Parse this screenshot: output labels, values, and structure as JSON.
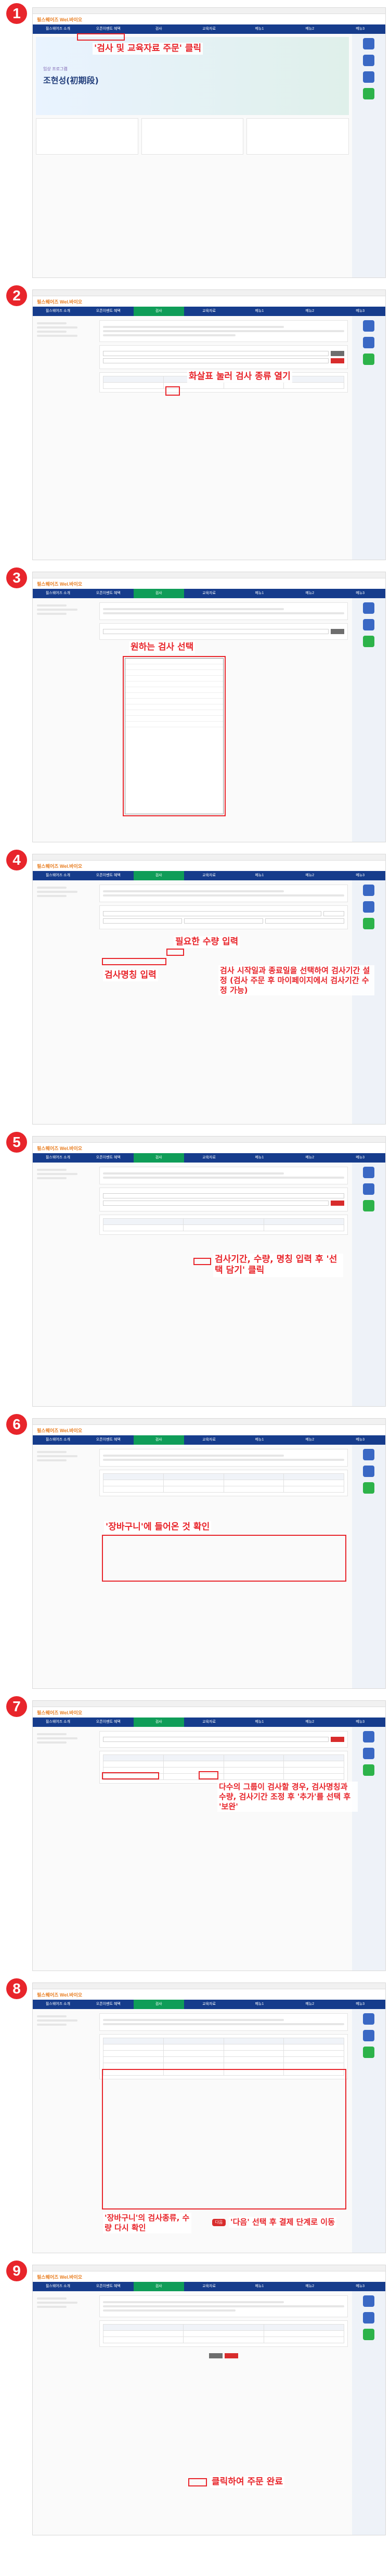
{
  "site": {
    "logo_main": "필스웨어즈 ",
    "logo_accent": "Wel.바이오",
    "nav": [
      "필스웨어즈 소개",
      "오픈이벤트 혜택",
      "검사",
      "교육자료",
      "메뉴1",
      "메뉴2",
      "메뉴3"
    ],
    "banner_top": "임상 프로그램",
    "banner_main": "조현성(初期段)"
  },
  "colors": {
    "annotation": "#e8252b",
    "nav": "#163c8c",
    "active": "#0f9d58"
  },
  "steps": [
    {
      "number": "1",
      "annotations": [
        "'검사 및 교육자료 주문' 클릭"
      ]
    },
    {
      "number": "2",
      "annotations": [
        "화살표 눌러 검사 종류 열기"
      ]
    },
    {
      "number": "3",
      "annotations": [
        "원하는 검사 선택"
      ]
    },
    {
      "number": "4",
      "annotations": [
        "필요한 수량 입력",
        "검사명칭 입력",
        "검사 시작일과 종료일을 선택하여 검사기간 설정 (검사 주문 후 마이페이지에서 검사기간 수정 가능)"
      ]
    },
    {
      "number": "5",
      "annotations": [
        "검사기간, 수량, 명칭 입력 후 '선택 담기' 클릭"
      ]
    },
    {
      "number": "6",
      "annotations": [
        "'장바구니'에 들어온 것 확인"
      ]
    },
    {
      "number": "7",
      "annotations": [
        "다수의 그룹이 검사할 경우, 검사명칭과 수량, 검사기간 조정 후 '추가'를 선택 후 '보완'"
      ]
    },
    {
      "number": "8",
      "annotations": [
        "'장바구니'의 검사종류, 수량 다시 확인",
        "'다음' 선택 후 결제 단계로 이동"
      ],
      "next_pill": "다음"
    },
    {
      "number": "9",
      "annotations": [
        "클릭하여 주문 완료"
      ]
    }
  ]
}
